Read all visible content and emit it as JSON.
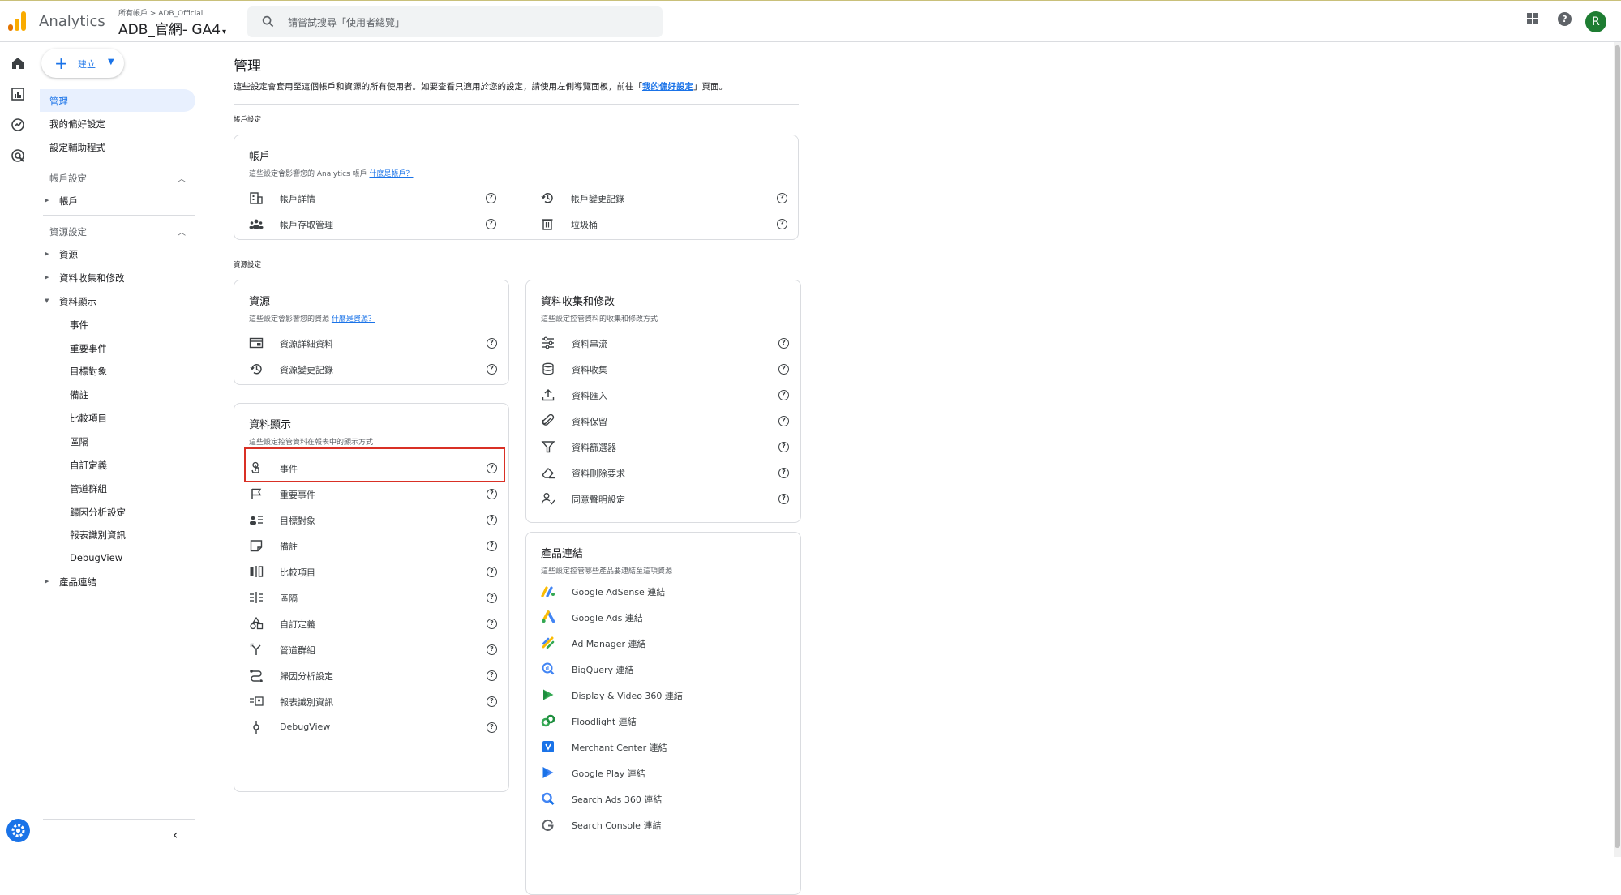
{
  "topbar": {
    "app_name": "Analytics",
    "account_path": "所有帳戶 > ADB_Official",
    "property_name": "ADB_官網- GA4",
    "search_placeholder": "請嘗試搜尋「使用者總覽」",
    "help_icon_text": "?",
    "avatar_letter": "R",
    "avatar_color": "#1e7d32"
  },
  "sidenav": {
    "create_label": "建立",
    "top_items": [
      "管理",
      "我的偏好設定",
      "設定輔助程式"
    ],
    "account_section": "帳戶設定",
    "account_items": [
      "帳戶"
    ],
    "property_section": "資源設定",
    "property_items": [
      "資源",
      "資料收集和修改",
      "資料顯示"
    ],
    "display_subitems": [
      "事件",
      "重要事件",
      "目標對象",
      "備註",
      "比較項目",
      "區隔",
      "自訂定義",
      "管道群組",
      "歸因分析設定",
      "報表識別資訊",
      "DebugView"
    ],
    "product_links": "產品連結",
    "collapse_icon": "‹"
  },
  "main": {
    "title": "管理",
    "desc_pre": "這些設定會套用至這個帳戶和資源的所有使用者。如要查看只適用於您的設定，請使用左側導覽面板，前往「",
    "desc_link": "我的偏好設定",
    "desc_post": "」頁面。",
    "account_settings_label": "帳戶設定",
    "property_settings_label": "資源設定",
    "account_card": {
      "title": "帳戶",
      "sub": "這些設定會影響您的 Analytics 帳戶",
      "sub_link": "什麼是帳戶？",
      "rows_left": [
        "帳戶詳情",
        "帳戶存取管理"
      ],
      "rows_right": [
        "帳戶變更記錄",
        "垃圾桶"
      ]
    },
    "property_card": {
      "title": "資源",
      "sub": "這些設定會影響您的資源",
      "sub_link": "什麼是資源？",
      "rows": [
        "資源詳細資料",
        "資源變更記錄"
      ]
    },
    "display_card": {
      "title": "資料顯示",
      "sub": "這些設定控管資料在報表中的顯示方式",
      "rows": [
        "事件",
        "重要事件",
        "目標對象",
        "備註",
        "比較項目",
        "區隔",
        "自訂定義",
        "管道群組",
        "歸因分析設定",
        "報表識別資訊",
        "DebugView"
      ]
    },
    "collection_card": {
      "title": "資料收集和修改",
      "sub": "這些設定控管資料的收集和修改方式",
      "rows": [
        "資料串流",
        "資料收集",
        "資料匯入",
        "資料保留",
        "資料篩選器",
        "資料刪除要求",
        "同意聲明設定"
      ]
    },
    "links_card": {
      "title": "產品連結",
      "sub": "這些設定控管哪些產品要連結至這項資源",
      "rows": [
        "Google AdSense 連結",
        "Google Ads 連結",
        "Ad Manager 連結",
        "BigQuery 連結",
        "Display & Video 360 連結",
        "Floodlight 連結",
        "Merchant Center 連結",
        "Google Play 連結",
        "Search Ads 360 連結",
        "Search Console 連結"
      ]
    },
    "help_glyph": "?"
  },
  "colors": {
    "accent": "#1a73e8",
    "highlight": "#d93025",
    "ga_orange": "#f9ab00",
    "ga_dark_orange": "#e37400"
  }
}
